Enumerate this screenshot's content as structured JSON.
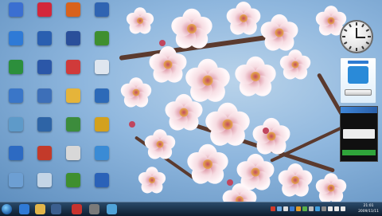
{
  "desktop_icons": [
    {
      "label": "",
      "color": "#3b6fd1"
    },
    {
      "label": "",
      "color": "#2f7ad6"
    },
    {
      "label": "",
      "color": "#2c8f3c"
    },
    {
      "label": "",
      "color": "#3a76c8"
    },
    {
      "label": "",
      "color": "#5e9ac9"
    },
    {
      "label": "",
      "color": "#2d6ac2"
    },
    {
      "label": "",
      "color": "#6d9fd3"
    },
    {
      "label": "",
      "color": "#d3273b"
    },
    {
      "label": "",
      "color": "#2a5fb0"
    },
    {
      "label": "",
      "color": "#2b57a8"
    },
    {
      "label": "",
      "color": "#3d6fb8"
    },
    {
      "label": "",
      "color": "#2e64a6"
    },
    {
      "label": "",
      "color": "#c33a2a"
    },
    {
      "label": "",
      "color": "#c4d5e6"
    },
    {
      "label": "",
      "color": "#d9621c"
    },
    {
      "label": "",
      "color": "#2a4f9a"
    },
    {
      "label": "",
      "color": "#d03a3a"
    },
    {
      "label": "",
      "color": "#e5b43a"
    },
    {
      "label": "",
      "color": "#3c8c3c"
    },
    {
      "label": "",
      "color": "#d8d8d8"
    },
    {
      "label": "",
      "color": "#3f8f2f"
    },
    {
      "label": "",
      "color": "#2f64b2"
    },
    {
      "label": "",
      "color": "#3f8f2f"
    },
    {
      "label": "",
      "color": "#dfe6ef"
    },
    {
      "label": "",
      "color": "#2d6ab8"
    },
    {
      "label": "",
      "color": "#d3a11e"
    },
    {
      "label": "",
      "color": "#3a8bd5"
    },
    {
      "label": "",
      "color": "#2a62b8"
    },
    {
      "label": "",
      "color": "#e8e8e8"
    }
  ],
  "gadgets": {
    "ad_label": "",
    "ad_button": "",
    "news_lines": [
      "",
      "",
      "",
      "",
      "",
      ""
    ]
  },
  "taskbar": {
    "time": "21:01",
    "date": "2009/11/11"
  }
}
